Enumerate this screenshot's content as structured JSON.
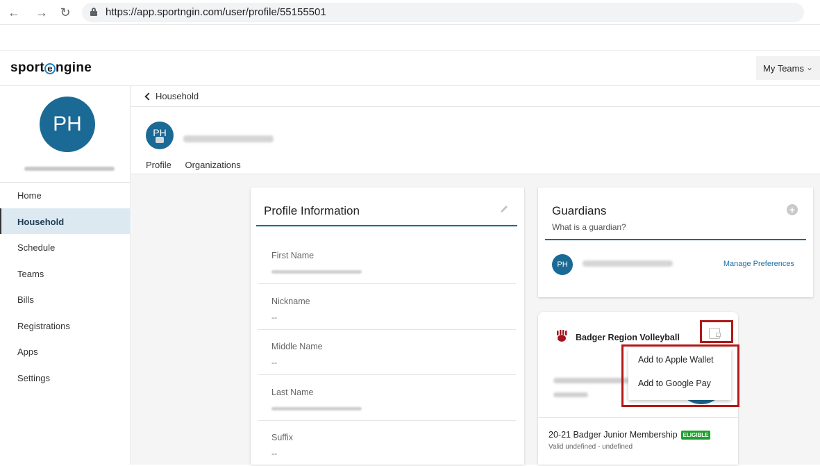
{
  "browser": {
    "url": "https://app.sportngin.com/user/profile/55155501"
  },
  "header": {
    "logo_text_a": "sport",
    "logo_text_o": "e",
    "logo_text_b": "ngine",
    "my_teams_label": "My Teams"
  },
  "sidebar": {
    "avatar_initials": "PH",
    "items": [
      {
        "label": "Home"
      },
      {
        "label": "Household"
      },
      {
        "label": "Schedule"
      },
      {
        "label": "Teams"
      },
      {
        "label": "Bills"
      },
      {
        "label": "Registrations"
      },
      {
        "label": "Apps"
      },
      {
        "label": "Settings"
      }
    ],
    "active_item": "Household"
  },
  "main": {
    "breadcrumb": "Household",
    "avatar_initials": "PH",
    "tabs": [
      {
        "label": "Profile"
      },
      {
        "label": "Organizations"
      }
    ],
    "active_tab": "Profile"
  },
  "profile_card": {
    "title": "Profile Information",
    "fields": [
      {
        "label": "First Name",
        "value": ""
      },
      {
        "label": "Nickname",
        "value": "--"
      },
      {
        "label": "Middle Name",
        "value": "--"
      },
      {
        "label": "Last Name",
        "value": ""
      },
      {
        "label": "Suffix",
        "value": "--"
      }
    ]
  },
  "guardians_card": {
    "title": "Guardians",
    "subtitle": "What is a guardian?",
    "guardian_initials": "PH",
    "manage_link": "Manage Preferences"
  },
  "badge_card": {
    "org_name": "Badger Region Volleyball",
    "membership": "20-21 Badger Junior Membership",
    "eligibility": "ELIGIBLE",
    "validity": "Valid undefined - undefined"
  },
  "wallet_menu": {
    "items": [
      "Add to Apple Wallet",
      "Add to Google Pay"
    ]
  },
  "colors": {
    "brand_blue": "#1b6a95",
    "highlight_red": "#b01818",
    "eligible_green": "#1ea12f"
  }
}
